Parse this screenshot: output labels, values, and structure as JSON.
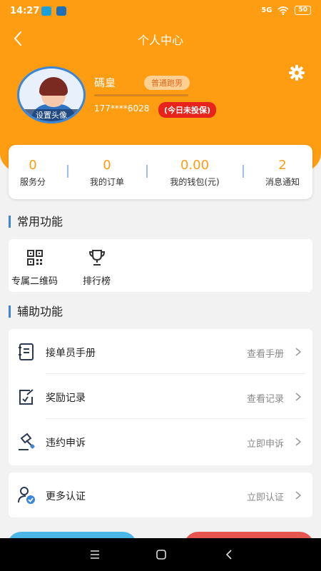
{
  "status_bar": {
    "time": "14:27",
    "signal": "5G",
    "battery": "50"
  },
  "nav": {
    "title": "个人中心"
  },
  "profile": {
    "avatar_label": "设置头像",
    "name": "碼皇",
    "badge": "普通跑男",
    "phone": "177****6028",
    "insurance_status": "(今日未投保)"
  },
  "stats": [
    {
      "value": "0",
      "label": "服务分"
    },
    {
      "value": "0",
      "label": "我的订单"
    },
    {
      "value": "0.00",
      "label": "我的钱包(元)"
    },
    {
      "value": "2",
      "label": "消息通知"
    }
  ],
  "common": {
    "title": "常用功能",
    "items": [
      {
        "label": "专属二维码",
        "icon": "qr-code-icon"
      },
      {
        "label": "排行榜",
        "icon": "trophy-icon"
      }
    ]
  },
  "aux": {
    "title": "辅助功能",
    "items": [
      {
        "label": "接单员手册",
        "action": "查看手册",
        "icon": "manual-icon"
      },
      {
        "label": "奖励记录",
        "action": "查看记录",
        "icon": "reward-record-icon"
      },
      {
        "label": "违约申诉",
        "action": "立即申诉",
        "icon": "gavel-icon"
      }
    ]
  },
  "more": {
    "label": "更多认证",
    "action": "立即认证",
    "icon": "user-verify-icon"
  },
  "colors": {
    "primary": "#ff9d12",
    "accent": "#3b86d6",
    "danger": "#e8231c"
  }
}
